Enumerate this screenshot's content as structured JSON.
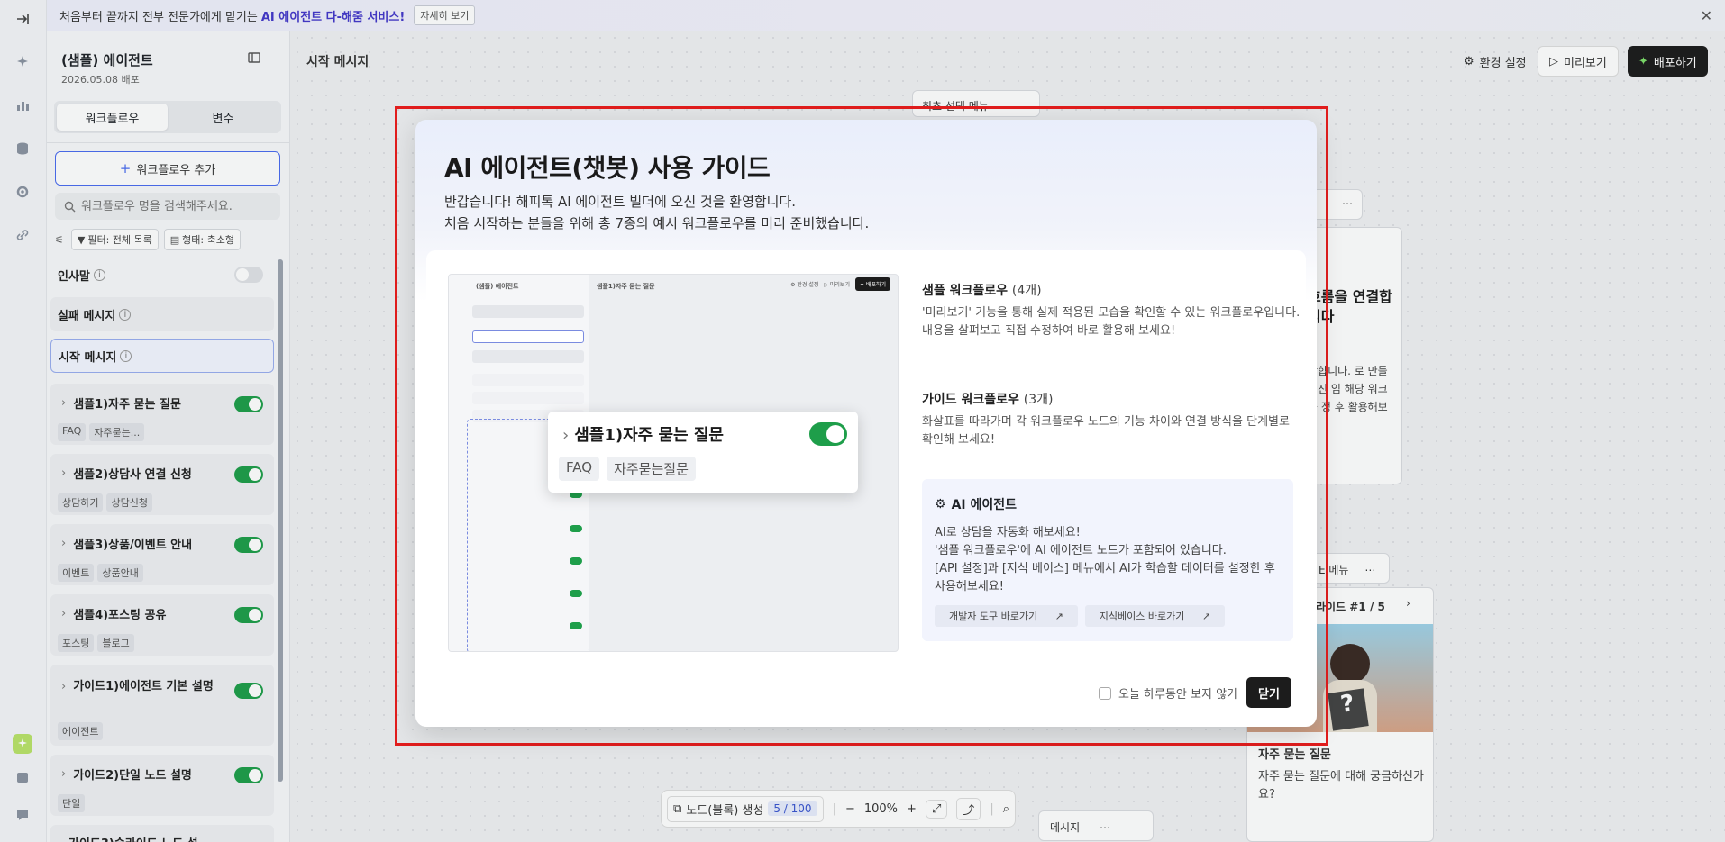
{
  "banner": {
    "text": "처음부터 끝까지 전부 전문가에게 맡기는",
    "highlight": "AI 에이전트 다-해줌 서비스!",
    "more": "자세히 보기"
  },
  "sidebar": {
    "title": "(샘플) 에이전트",
    "date": "2026.05.08 배포",
    "tabs": [
      "워크플로우",
      "변수"
    ],
    "add_button": "워크플로우 추가",
    "search_placeholder": "워크플로우 명을 검색해주세요.",
    "filter_list": "필터: 전체 목록",
    "filter_state": "형태: 축소형",
    "greeting": "인사말",
    "fail_message": "실패 메시지",
    "start_message": "시작 메시지",
    "workflows": [
      {
        "name": "샘플1)자주 묻는 질문",
        "tags": [
          "FAQ",
          "자주묻는..."
        ]
      },
      {
        "name": "샘플2)상담사 연결 신청",
        "tags": [
          "상담하기",
          "상담신청"
        ]
      },
      {
        "name": "샘플3)상품/이벤트 안내",
        "tags": [
          "이벤트",
          "상품안내"
        ]
      },
      {
        "name": "샘플4)포스팅 공유",
        "tags": [
          "포스팅",
          "블로그"
        ]
      },
      {
        "name": "가이드1)에이전트 기본 설명",
        "tags": [
          "에이전트"
        ]
      },
      {
        "name": "가이드2)단일 노드 설명",
        "tags": [
          "단일"
        ]
      },
      {
        "name": "가이드3)슬라이드 노드 설",
        "tags": []
      }
    ]
  },
  "canvas": {
    "title": "시작 메시지",
    "settings": "환경 설정",
    "preview": "미리보기",
    "deploy": "배포하기",
    "node_top": "최초 선택 메뉴",
    "right_card_title": "흐름을 연결합니다",
    "right_card_sub": "시",
    "right_card_text": "작합니다. 로 만들어진 임 해당 워크플 정 후 활용해보",
    "slide_label": "라이드 #1 / 5",
    "menu_label": "E 메뉴",
    "faq_title": "자주 묻는 질문",
    "faq_text": "자주 묻는 질문에 대해 궁금하신가요?",
    "bottom_message": "메시지",
    "node_create": "노드(블록) 생성",
    "node_count": "5 / 100",
    "zoom": "100%"
  },
  "modal": {
    "title": "AI 에이전트(챗봇) 사용 가이드",
    "sub1": "반갑습니다! 해피톡 AI 에이전트 빌더에 오신 것을 환영합니다.",
    "sub2": "처음 시작하는 분들을 위해 총 7종의 예시 워크플로우를 미리 준비했습니다.",
    "preview_popup_title": "샘플1)자주 묻는 질문",
    "preview_popup_tags": [
      "FAQ",
      "자주묻는질문"
    ],
    "sample_heading": "샘플 워크플로우",
    "sample_count": "(4개)",
    "sample_text": "'미리보기' 기능을 통해 실제 적용된 모습을 확인할 수 있는 워크플로우입니다. 내용을 살펴보고 직접 수정하여 바로 활용해 보세요!",
    "guide_heading": "가이드 워크플로우",
    "guide_count": "(3개)",
    "guide_text": "화살표를 따라가며 각 워크플로우 노드의 기능 차이와 연결 방식을 단계별로 확인해 보세요!",
    "ai_heading": "AI 에이전트",
    "ai_text1": "AI로 상담을 자동화 해보세요!",
    "ai_text2": "'샘플 워크플로우'에 AI 에이전트 노드가 포함되어 있습니다.",
    "ai_text3": "[API 설정]과 [지식 베이스] 메뉴에서 AI가 학습할 데이터를 설정한 후 사용해보세요!",
    "dev_link": "개발자 도구 바로가기",
    "kb_link": "지식베이스 바로가기",
    "dont_show": "오늘 하루동안 보지 않기",
    "close": "닫기"
  }
}
